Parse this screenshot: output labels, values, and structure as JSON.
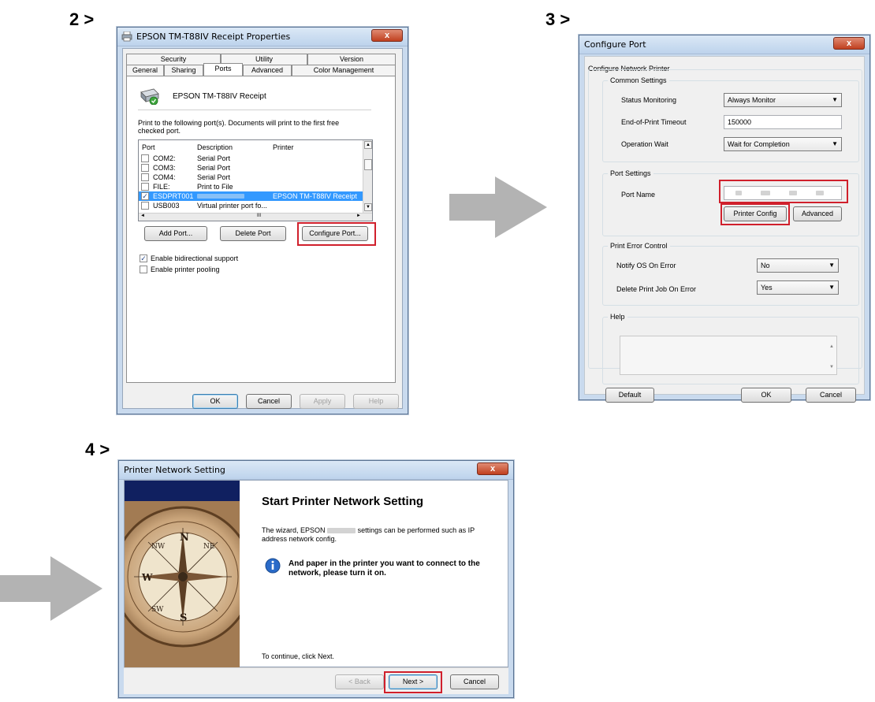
{
  "steps": {
    "step2": "2 >",
    "step3": "3 >",
    "step4": "4 >"
  },
  "colors": {
    "highlight": "#d0202c",
    "arrow": "#b3b3b3",
    "selection": "#3399ff"
  },
  "dialog_props": {
    "title": "EPSON TM-T88IV Receipt Properties",
    "close_glyph": "x",
    "tabs_row1": [
      "Security",
      "Utility",
      "Version"
    ],
    "tabs_row2": [
      "General",
      "Sharing",
      "Ports",
      "Advanced",
      "Color Management"
    ],
    "printer_name": "EPSON TM-T88IV Receipt",
    "instructions": "Print to the following port(s). Documents will print to the first free checked port.",
    "columns": [
      "Port",
      "Description",
      "Printer"
    ],
    "ports": [
      {
        "port": "COM2:",
        "desc": "Serial Port",
        "printer": "",
        "checked": false
      },
      {
        "port": "COM3:",
        "desc": "Serial Port",
        "printer": "",
        "checked": false
      },
      {
        "port": "COM4:",
        "desc": "Serial Port",
        "printer": "",
        "checked": false
      },
      {
        "port": "FILE:",
        "desc": "Print to File",
        "printer": "",
        "checked": false
      },
      {
        "port": "ESDPRT001",
        "desc": "",
        "printer": "EPSON TM-T88IV Receipt",
        "checked": true
      },
      {
        "port": "USB003",
        "desc": "Virtual printer port fo...",
        "printer": "",
        "checked": false
      }
    ],
    "scroll_glyph": "III",
    "add_port": "Add Port...",
    "delete_port": "Delete Port",
    "configure_port": "Configure Port...",
    "bidirectional": "Enable bidirectional support",
    "pooling": "Enable printer pooling",
    "ok": "OK",
    "cancel": "Cancel",
    "apply": "Apply",
    "help": "Help"
  },
  "dialog_config": {
    "title": "Configure Port",
    "close_glyph": "x",
    "outer_group": "Configure Network Printer",
    "common_group": "Common Settings",
    "status_label": "Status Monitoring",
    "status_value": "Always Monitor",
    "timeout_label": "End-of-Print Timeout",
    "timeout_value": "150000",
    "wait_label": "Operation Wait",
    "wait_value": "Wait for Completion",
    "port_group": "Port Settings",
    "port_name_label": "Port Name",
    "printer_config": "Printer Config",
    "advanced": "Advanced",
    "error_group": "Print Error Control",
    "notify_label": "Notify OS On Error",
    "notify_value": "No",
    "delete_label": "Delete Print Job On Error",
    "delete_value": "Yes",
    "help_group": "Help",
    "default_btn": "Default",
    "ok": "OK",
    "cancel": "Cancel"
  },
  "dialog_wizard": {
    "title": "Printer Network Setting",
    "close_glyph": "x",
    "heading": "Start Printer Network Setting",
    "desc_pre": "The wizard, EPSON",
    "desc_post": "settings can be performed such as IP address network config.",
    "info_text": "And paper in the printer you want to connect to the network, please turn it on.",
    "continue_text": "To continue, click Next.",
    "back": "< Back",
    "next": "Next >",
    "cancel": "Cancel",
    "compass_letters": {
      "n": "N",
      "s": "S",
      "w": "W",
      "nw": "NW",
      "ne": "NE",
      "sw": "SW"
    }
  }
}
